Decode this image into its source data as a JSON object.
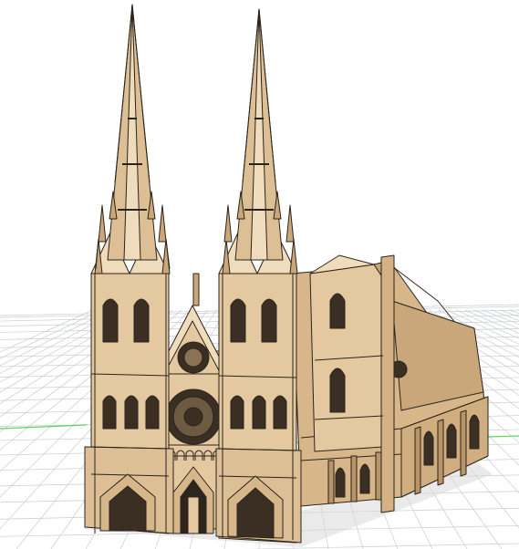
{
  "viewport": {
    "background": "#ffffff",
    "grid_color": "#c9ccd1",
    "axis_color": "#5cd65c",
    "model_fill": "#e4c9a0",
    "model_fill_light": "#efdcbc",
    "model_fill_dark": "#c9a77a",
    "model_stroke": "#2b241c"
  },
  "model": {
    "icon": "cathedral-model-icon"
  }
}
